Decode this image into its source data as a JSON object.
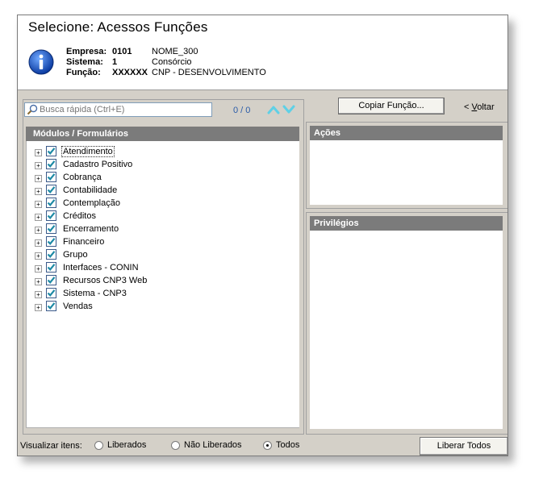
{
  "window": {
    "title": "Selecione: Acessos Funções"
  },
  "info": {
    "empresa_label": "Empresa:",
    "empresa_code": "0101",
    "empresa_name": "NOME_300",
    "sistema_label": "Sistema:",
    "sistema_code": "1",
    "sistema_name": "Consórcio",
    "funcao_label": "Função:",
    "funcao_code": "XXXXXX",
    "funcao_name": "CNP - DESENVOLVIMENTO"
  },
  "search": {
    "placeholder": "Busca rápida (Ctrl+E)",
    "counter": "0 / 0"
  },
  "modules": {
    "header": "Módulos / Formulários",
    "items": [
      {
        "label": "Atendimento",
        "checked": true
      },
      {
        "label": "Cadastro Positivo",
        "checked": true
      },
      {
        "label": "Cobrança",
        "checked": true
      },
      {
        "label": "Contabilidade",
        "checked": true
      },
      {
        "label": "Contemplação",
        "checked": true
      },
      {
        "label": "Créditos",
        "checked": true
      },
      {
        "label": "Encerramento",
        "checked": true
      },
      {
        "label": "Financeiro",
        "checked": true
      },
      {
        "label": "Grupo",
        "checked": true
      },
      {
        "label": "Interfaces - CONIN",
        "checked": true
      },
      {
        "label": "Recursos CNP3 Web",
        "checked": true
      },
      {
        "label": "Sistema - CNP3",
        "checked": true
      },
      {
        "label": "Vendas",
        "checked": true
      }
    ]
  },
  "toolbar": {
    "copy_label": "Copiar Função...",
    "back_label": "< Voltar"
  },
  "acoes": {
    "header": "Ações"
  },
  "privilegios": {
    "header": "Privilégios"
  },
  "footer": {
    "view_label": "Visualizar itens:",
    "options": [
      {
        "label": "Liberados",
        "selected": false
      },
      {
        "label": "Não Liberados",
        "selected": false
      },
      {
        "label": "Todos",
        "selected": true
      }
    ],
    "release_all_label": "Liberar Todos"
  },
  "colors": {
    "header_bar": "#7b7b7b",
    "check_mark": "#1e8aa6",
    "arrow": "#5fd0e6"
  }
}
